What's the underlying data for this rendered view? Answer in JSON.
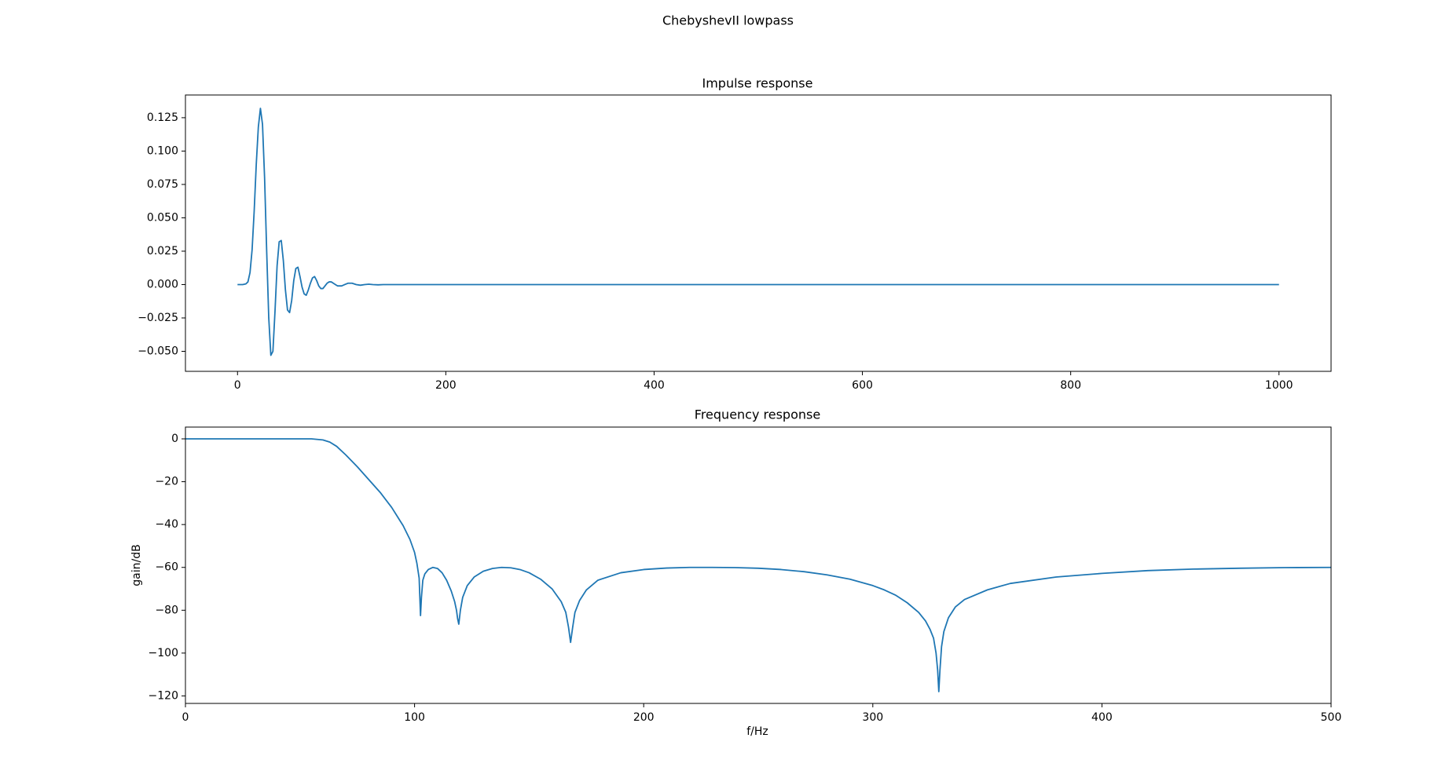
{
  "figure": {
    "suptitle": "ChebyshevII lowpass"
  },
  "colors": {
    "line": "#1f77b4",
    "axes": "#000000",
    "background": "#ffffff"
  },
  "chart_data": [
    {
      "type": "line",
      "title": "Impulse response",
      "xlabel": "",
      "ylabel": "",
      "xlim": [
        -50,
        1050
      ],
      "ylim": [
        -0.065,
        0.142
      ],
      "xticks": [
        0,
        200,
        400,
        600,
        800,
        1000
      ],
      "xtick_labels": [
        "0",
        "200",
        "400",
        "600",
        "800",
        "1000"
      ],
      "yticks": [
        -0.05,
        -0.025,
        0.0,
        0.025,
        0.05,
        0.075,
        0.1,
        0.125
      ],
      "ytick_labels": [
        "−0.050",
        "−0.025",
        "0.000",
        "0.025",
        "0.050",
        "0.075",
        "0.100",
        "0.125"
      ],
      "grid": false,
      "series": [
        {
          "x": [
            0,
            5,
            8,
            10,
            12,
            14,
            16,
            18,
            20,
            22,
            24,
            26,
            28,
            30,
            32,
            34,
            36,
            38,
            40,
            42,
            44,
            46,
            48,
            50,
            52,
            54,
            56,
            58,
            60,
            62,
            64,
            66,
            68,
            70,
            72,
            74,
            76,
            78,
            80,
            82,
            84,
            86,
            88,
            90,
            92,
            94,
            96,
            98,
            100,
            103,
            106,
            110,
            114,
            118,
            122,
            126,
            130,
            135,
            140,
            150,
            160,
            200,
            400,
            600,
            800,
            1000
          ],
          "y": [
            0,
            0,
            0.0005,
            0.002,
            0.009,
            0.026,
            0.055,
            0.09,
            0.118,
            0.132,
            0.12,
            0.08,
            0.025,
            -0.025,
            -0.053,
            -0.05,
            -0.02,
            0.014,
            0.032,
            0.033,
            0.018,
            -0.004,
            -0.019,
            -0.021,
            -0.012,
            0.003,
            0.012,
            0.013,
            0.006,
            -0.002,
            -0.007,
            -0.008,
            -0.004,
            0.001,
            0.005,
            0.006,
            0.003,
            -0.001,
            -0.003,
            -0.003,
            -0.001,
            0.001,
            0.002,
            0.002,
            0.001,
            0.0,
            -0.001,
            -0.001,
            -0.001,
            0.0,
            0.001,
            0.001,
            0.0,
            -0.0005,
            0.0,
            0.0003,
            0.0,
            -0.0002,
            0.0,
            0.0,
            0,
            0,
            0,
            0,
            0,
            0
          ]
        }
      ]
    },
    {
      "type": "line",
      "title": "Frequency response",
      "xlabel": "f/Hz",
      "ylabel": "gain/dB",
      "xlim": [
        0,
        500
      ],
      "ylim": [
        -123.5,
        5.5
      ],
      "xticks": [
        0,
        100,
        200,
        300,
        400,
        500
      ],
      "xtick_labels": [
        "0",
        "100",
        "200",
        "300",
        "400",
        "500"
      ],
      "yticks": [
        0,
        -20,
        -40,
        -60,
        -80,
        -100,
        -120
      ],
      "ytick_labels": [
        "0",
        "−20",
        "−40",
        "−60",
        "−80",
        "−100",
        "−120"
      ],
      "grid": false,
      "series": [
        {
          "x": [
            0,
            20,
            40,
            55,
            60,
            63,
            66,
            70,
            75,
            80,
            85,
            90,
            95,
            98,
            100,
            101,
            102,
            102.6,
            103,
            103.6,
            104.5,
            106,
            108,
            110,
            112,
            114,
            116,
            117.5,
            118.3,
            118.8,
            119.3,
            120,
            121,
            123,
            126,
            130,
            134,
            138,
            142,
            146,
            150,
            155,
            160,
            164,
            166,
            167.2,
            168.1,
            169,
            170,
            172,
            175,
            180,
            190,
            200,
            210,
            220,
            230,
            240,
            250,
            260,
            270,
            280,
            290,
            300,
            305,
            310,
            315,
            320,
            323,
            325,
            326.5,
            327.6,
            328.3,
            328.8,
            329.3,
            330,
            331,
            333,
            336,
            340,
            350,
            360,
            380,
            400,
            420,
            440,
            460,
            480,
            500
          ],
          "y": [
            0,
            0,
            0,
            0,
            -0.5,
            -1.5,
            -3.5,
            -7.5,
            -13,
            -19,
            -25,
            -32,
            -40.5,
            -47,
            -53,
            -58,
            -65,
            -82.5,
            -74,
            -66,
            -63,
            -61,
            -60,
            -60.5,
            -62.5,
            -66,
            -71,
            -76,
            -80,
            -84,
            -86.5,
            -80,
            -74,
            -68.5,
            -64.5,
            -61.8,
            -60.5,
            -60,
            -60.2,
            -61,
            -62.5,
            -65.5,
            -70,
            -76,
            -81,
            -88,
            -95,
            -88,
            -81,
            -75.5,
            -70.5,
            -66,
            -62.5,
            -61,
            -60.3,
            -60,
            -60,
            -60.1,
            -60.4,
            -61,
            -62,
            -63.5,
            -65.5,
            -68.5,
            -70.5,
            -73,
            -76.5,
            -81,
            -85,
            -89,
            -93,
            -100,
            -108,
            -118,
            -108,
            -97,
            -90,
            -83.5,
            -78.5,
            -75,
            -70.5,
            -67.5,
            -64.5,
            -62.8,
            -61.5,
            -60.8,
            -60.4,
            -60.1,
            -60
          ]
        }
      ]
    }
  ]
}
